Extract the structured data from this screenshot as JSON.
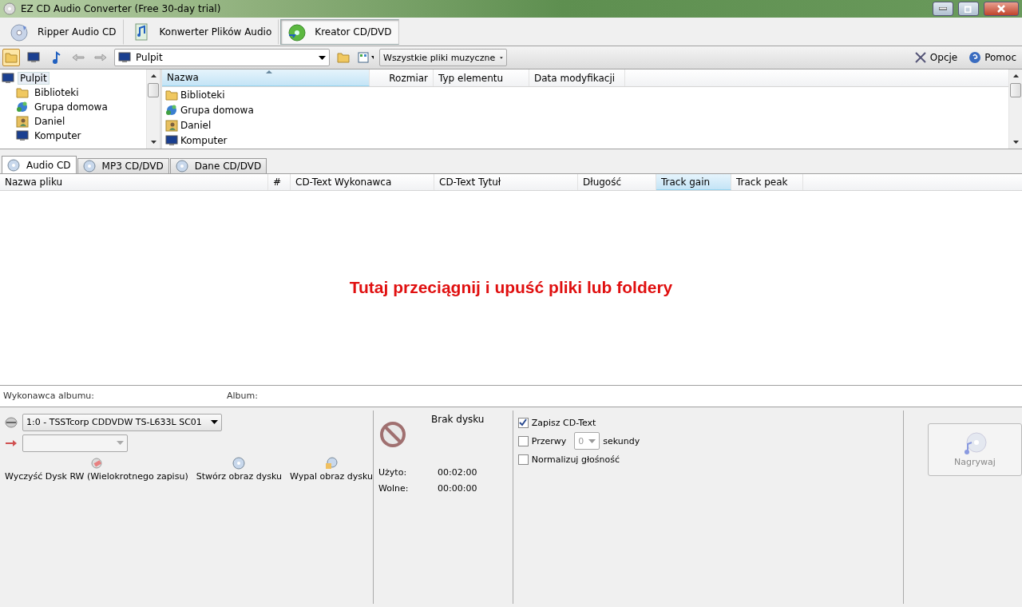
{
  "window": {
    "title": "EZ CD Audio Converter (Free 30-day trial)"
  },
  "modes": [
    {
      "label": "Ripper Audio CD",
      "selected": false
    },
    {
      "label": "Konwerter Plików Audio",
      "selected": false
    },
    {
      "label": "Kreator CD/DVD",
      "selected": true
    }
  ],
  "toolbar": {
    "location": "Pulpit",
    "filter": "Wszystkie pliki muzyczne",
    "links": [
      "Opcje",
      "Pomoc"
    ]
  },
  "folder_tree": [
    {
      "label": "Pulpit",
      "selected": true,
      "children": [
        {
          "label": "Biblioteki",
          "selected": false
        },
        {
          "label": "Grupa domowa",
          "selected": false
        },
        {
          "label": "Daniel",
          "selected": false
        },
        {
          "label": "Komputer",
          "selected": false
        }
      ]
    }
  ],
  "file_list": {
    "columns": [
      {
        "label": "Nazwa",
        "sorted": true
      },
      {
        "label": "Rozmiar",
        "sorted": false
      },
      {
        "label": "Typ elementu",
        "sorted": false
      },
      {
        "label": "Data modyfikacji",
        "sorted": false
      }
    ],
    "rows": [
      "Biblioteki",
      "Grupa domowa",
      "Daniel",
      "Komputer"
    ]
  },
  "disc_tabs": [
    {
      "label": "Audio CD",
      "selected": true
    },
    {
      "label": "MP3 CD/DVD",
      "selected": false
    },
    {
      "label": "Dane CD/DVD",
      "selected": false
    }
  ],
  "track_columns": [
    {
      "label": "Nazwa pliku",
      "selected": false
    },
    {
      "label": "#",
      "selected": false
    },
    {
      "label": "CD-Text Wykonawca",
      "selected": false
    },
    {
      "label": "CD-Text Tytuł",
      "selected": false
    },
    {
      "label": "Długość",
      "selected": false
    },
    {
      "label": "Track gain",
      "selected": true
    },
    {
      "label": "Track peak",
      "selected": false
    }
  ],
  "drop_hint": "Tutaj przeciągnij i upuść pliki lub foldery",
  "album_fields": [
    "Wykonawca albumu:",
    "Album:"
  ],
  "drive": {
    "device": "1:0 - TSSTcorp CDDVDW TS-L633L SC01"
  },
  "actions": [
    "Wyczyść Dysk RW (Wielokrotnego zapisu)",
    "Stwórz obraz dysku",
    "Wypal obraz dysku"
  ],
  "disc_status": {
    "status": "Brak dysku",
    "used_label": "Użyto:",
    "used": "00:02:00",
    "free_label": "Wolne:",
    "free": "00:00:00"
  },
  "options": [
    {
      "kind": "checkbox",
      "label": "Zapisz CD-Text",
      "checked": true
    },
    {
      "kind": "gap",
      "label": "Przerwy",
      "checked": false,
      "value": "0",
      "unit": "sekundy"
    },
    {
      "kind": "checkbox",
      "label": "Normalizuj głośność",
      "checked": false
    }
  ],
  "burn_button": {
    "label": "Nagrywaj",
    "disabled": true
  }
}
